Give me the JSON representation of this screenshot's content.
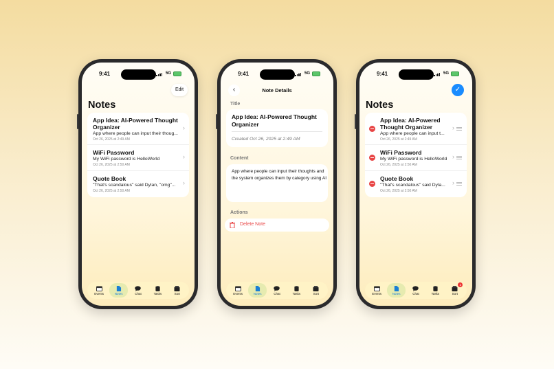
{
  "status": {
    "time": "9:41",
    "network": "5G"
  },
  "phone1": {
    "title": "Notes",
    "edit_label": "Edit",
    "notes": [
      {
        "title": "App Idea: AI-Powered Thought Organizer",
        "snippet": "App where people can input their thoug...",
        "date": "Oct 26, 2025 at 2:49 AM"
      },
      {
        "title": "WiFi Password",
        "snippet": "My WiFi password is HelloWorld",
        "date": "Oct 26, 2025 at 2:50 AM"
      },
      {
        "title": "Quote Book",
        "snippet": "\"That's scandalous\" said Dylan, \"omg\"...",
        "date": "Oct 26, 2025 at 2:50 AM"
      }
    ]
  },
  "phone2": {
    "nav_title": "Note Details",
    "title_section": "Title",
    "note_title": "App Idea: AI-Powered Thought Organizer",
    "created": "Created Oct 26, 2025 at 2:49 AM",
    "content_section": "Content",
    "content": "App where people can input their thoughts and the system organizes them by category using AI",
    "actions_section": "Actions",
    "delete_label": "Delete Note"
  },
  "phone3": {
    "title": "Notes",
    "notes": [
      {
        "title": "App Idea: AI-Powered Thought Organizer",
        "snippet": "App where people can input t...",
        "date": "Oct 26, 2025 at 2:49 AM"
      },
      {
        "title": "WiFi Password",
        "snippet": "My WiFi password is HelloWorld",
        "date": "Oct 26, 2025 at 2:50 AM"
      },
      {
        "title": "Quote Book",
        "snippet": "\"That's scandalous\" said Dyla...",
        "date": "Oct 26, 2025 at 2:50 AM"
      }
    ],
    "sort_badge": "1"
  },
  "tabs": [
    {
      "label": "Events",
      "icon": "calendar-icon"
    },
    {
      "label": "Notes",
      "icon": "document-icon"
    },
    {
      "label": "Chat",
      "icon": "chat-bubble-icon"
    },
    {
      "label": "Tasks",
      "icon": "clipboard-icon"
    },
    {
      "label": "Sort",
      "icon": "inbox-tray-icon"
    }
  ],
  "colors": {
    "accent": "#1a8cff",
    "delete": "#e84545",
    "tab_active_bg": "#e6ebb0",
    "tab_bar_bg": "#fff3c6"
  }
}
